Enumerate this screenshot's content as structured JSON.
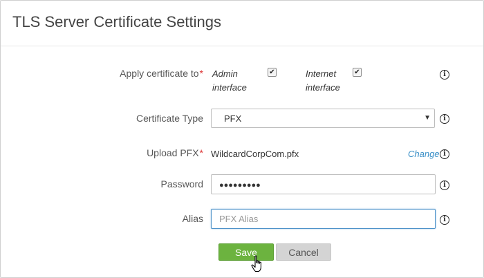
{
  "dialog": {
    "title": "TLS Server Certificate Settings"
  },
  "form": {
    "apply_label": "Apply certificate to",
    "required_mark": "*",
    "admin_label_line1": "Admin",
    "admin_label_line2": "interface",
    "admin_checked": true,
    "internet_label_line1": "Internet",
    "internet_label_line2": "interface",
    "internet_checked": true,
    "checkmark": "✔",
    "cert_type_label": "Certificate Type",
    "cert_type_value": "PFX",
    "upload_label": "Upload PFX",
    "upload_filename": "WildcardCorpCom.pfx",
    "change_link": "Change",
    "password_label": "Password",
    "password_mask": "●●●●●●●●●",
    "alias_label": "Alias",
    "alias_placeholder": "PFX Alias",
    "alias_value": ""
  },
  "buttons": {
    "save": "Save",
    "cancel": "Cancel"
  },
  "icons": {
    "info_glyph": "i",
    "select_arrow": "▼"
  }
}
